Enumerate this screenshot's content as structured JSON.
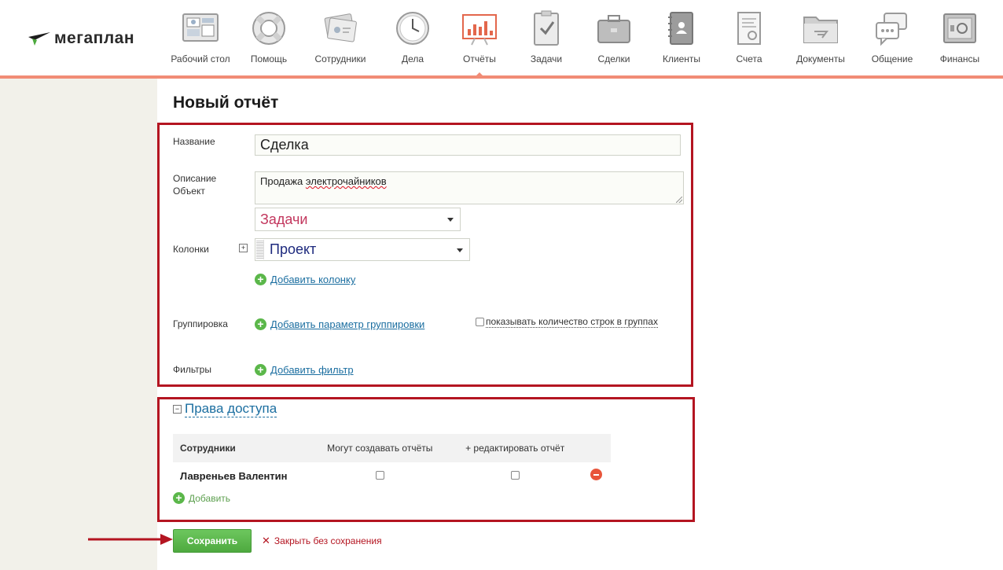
{
  "brand": {
    "logo_text": "мегаплан"
  },
  "nav": [
    {
      "label": "Рабочий стол",
      "icon": "desktop-icon"
    },
    {
      "label": "Помощь",
      "icon": "lifebuoy-icon"
    },
    {
      "label": "Сотрудники",
      "icon": "employees-icon"
    },
    {
      "label": "Дела",
      "icon": "clock-icon"
    },
    {
      "label": "Отчёты",
      "icon": "chart-board-icon",
      "active": true
    },
    {
      "label": "Задачи",
      "icon": "clipboard-check-icon"
    },
    {
      "label": "Сделки",
      "icon": "briefcase-icon"
    },
    {
      "label": "Клиенты",
      "icon": "address-book-icon"
    },
    {
      "label": "Счета",
      "icon": "invoice-icon"
    },
    {
      "label": "Документы",
      "icon": "folder-icon"
    },
    {
      "label": "Общение",
      "icon": "chat-icon"
    },
    {
      "label": "Финансы",
      "icon": "safe-icon"
    }
  ],
  "page": {
    "title": "Новый отчёт"
  },
  "form": {
    "name_label": "Название",
    "name_value": "Сделка",
    "desc_label": "Описание",
    "desc_value_plain": "Продажа ",
    "desc_value_spell": "электрочайников",
    "object_label": "Объект",
    "object_value": "Задачи",
    "columns_label": "Колонки",
    "columns_plus": "+",
    "column_value": "Проект",
    "add_column": "Добавить колонку",
    "grouping_label": "Группировка",
    "add_grouping": "Добавить параметр группировки",
    "show_rows_count": "показывать количество строк в группах",
    "filters_label": "Фильтры",
    "add_filter": "Добавить фильтр"
  },
  "access": {
    "toggle": "−",
    "title": "Права доступа",
    "columns": [
      "Сотрудники",
      "Могут создавать отчёты",
      "+ редактировать отчёт"
    ],
    "rows": [
      {
        "name": "Лавреньев Валентин",
        "can_create": false,
        "can_edit": false
      }
    ],
    "add_label": "Добавить"
  },
  "actions": {
    "save": "Сохранить",
    "close": "Закрыть без сохранения"
  },
  "colors": {
    "accent_line": "#f18c76",
    "highlight_frame": "#b41521",
    "link": "#1b6ea0",
    "save_green": "#5bb74a"
  }
}
